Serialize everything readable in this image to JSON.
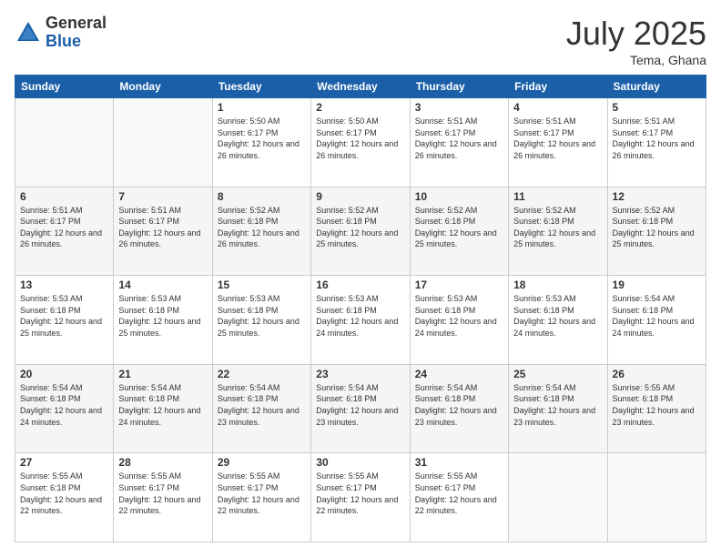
{
  "logo": {
    "general": "General",
    "blue": "Blue"
  },
  "header": {
    "month": "July 2025",
    "location": "Tema, Ghana"
  },
  "days_of_week": [
    "Sunday",
    "Monday",
    "Tuesday",
    "Wednesday",
    "Thursday",
    "Friday",
    "Saturday"
  ],
  "weeks": [
    [
      {
        "day": "",
        "info": ""
      },
      {
        "day": "",
        "info": ""
      },
      {
        "day": "1",
        "info": "Sunrise: 5:50 AM\nSunset: 6:17 PM\nDaylight: 12 hours and 26 minutes."
      },
      {
        "day": "2",
        "info": "Sunrise: 5:50 AM\nSunset: 6:17 PM\nDaylight: 12 hours and 26 minutes."
      },
      {
        "day": "3",
        "info": "Sunrise: 5:51 AM\nSunset: 6:17 PM\nDaylight: 12 hours and 26 minutes."
      },
      {
        "day": "4",
        "info": "Sunrise: 5:51 AM\nSunset: 6:17 PM\nDaylight: 12 hours and 26 minutes."
      },
      {
        "day": "5",
        "info": "Sunrise: 5:51 AM\nSunset: 6:17 PM\nDaylight: 12 hours and 26 minutes."
      }
    ],
    [
      {
        "day": "6",
        "info": "Sunrise: 5:51 AM\nSunset: 6:17 PM\nDaylight: 12 hours and 26 minutes."
      },
      {
        "day": "7",
        "info": "Sunrise: 5:51 AM\nSunset: 6:17 PM\nDaylight: 12 hours and 26 minutes."
      },
      {
        "day": "8",
        "info": "Sunrise: 5:52 AM\nSunset: 6:18 PM\nDaylight: 12 hours and 26 minutes."
      },
      {
        "day": "9",
        "info": "Sunrise: 5:52 AM\nSunset: 6:18 PM\nDaylight: 12 hours and 25 minutes."
      },
      {
        "day": "10",
        "info": "Sunrise: 5:52 AM\nSunset: 6:18 PM\nDaylight: 12 hours and 25 minutes."
      },
      {
        "day": "11",
        "info": "Sunrise: 5:52 AM\nSunset: 6:18 PM\nDaylight: 12 hours and 25 minutes."
      },
      {
        "day": "12",
        "info": "Sunrise: 5:52 AM\nSunset: 6:18 PM\nDaylight: 12 hours and 25 minutes."
      }
    ],
    [
      {
        "day": "13",
        "info": "Sunrise: 5:53 AM\nSunset: 6:18 PM\nDaylight: 12 hours and 25 minutes."
      },
      {
        "day": "14",
        "info": "Sunrise: 5:53 AM\nSunset: 6:18 PM\nDaylight: 12 hours and 25 minutes."
      },
      {
        "day": "15",
        "info": "Sunrise: 5:53 AM\nSunset: 6:18 PM\nDaylight: 12 hours and 25 minutes."
      },
      {
        "day": "16",
        "info": "Sunrise: 5:53 AM\nSunset: 6:18 PM\nDaylight: 12 hours and 24 minutes."
      },
      {
        "day": "17",
        "info": "Sunrise: 5:53 AM\nSunset: 6:18 PM\nDaylight: 12 hours and 24 minutes."
      },
      {
        "day": "18",
        "info": "Sunrise: 5:53 AM\nSunset: 6:18 PM\nDaylight: 12 hours and 24 minutes."
      },
      {
        "day": "19",
        "info": "Sunrise: 5:54 AM\nSunset: 6:18 PM\nDaylight: 12 hours and 24 minutes."
      }
    ],
    [
      {
        "day": "20",
        "info": "Sunrise: 5:54 AM\nSunset: 6:18 PM\nDaylight: 12 hours and 24 minutes."
      },
      {
        "day": "21",
        "info": "Sunrise: 5:54 AM\nSunset: 6:18 PM\nDaylight: 12 hours and 24 minutes."
      },
      {
        "day": "22",
        "info": "Sunrise: 5:54 AM\nSunset: 6:18 PM\nDaylight: 12 hours and 23 minutes."
      },
      {
        "day": "23",
        "info": "Sunrise: 5:54 AM\nSunset: 6:18 PM\nDaylight: 12 hours and 23 minutes."
      },
      {
        "day": "24",
        "info": "Sunrise: 5:54 AM\nSunset: 6:18 PM\nDaylight: 12 hours and 23 minutes."
      },
      {
        "day": "25",
        "info": "Sunrise: 5:54 AM\nSunset: 6:18 PM\nDaylight: 12 hours and 23 minutes."
      },
      {
        "day": "26",
        "info": "Sunrise: 5:55 AM\nSunset: 6:18 PM\nDaylight: 12 hours and 23 minutes."
      }
    ],
    [
      {
        "day": "27",
        "info": "Sunrise: 5:55 AM\nSunset: 6:18 PM\nDaylight: 12 hours and 22 minutes."
      },
      {
        "day": "28",
        "info": "Sunrise: 5:55 AM\nSunset: 6:17 PM\nDaylight: 12 hours and 22 minutes."
      },
      {
        "day": "29",
        "info": "Sunrise: 5:55 AM\nSunset: 6:17 PM\nDaylight: 12 hours and 22 minutes."
      },
      {
        "day": "30",
        "info": "Sunrise: 5:55 AM\nSunset: 6:17 PM\nDaylight: 12 hours and 22 minutes."
      },
      {
        "day": "31",
        "info": "Sunrise: 5:55 AM\nSunset: 6:17 PM\nDaylight: 12 hours and 22 minutes."
      },
      {
        "day": "",
        "info": ""
      },
      {
        "day": "",
        "info": ""
      }
    ]
  ]
}
